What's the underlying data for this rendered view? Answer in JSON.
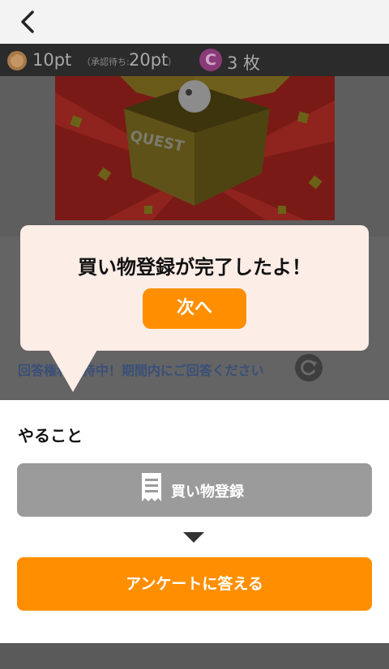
{
  "points": {
    "current": "10pt",
    "pending_label": "（承認待ち:",
    "pending_value": "20pt",
    "pending_close": "）",
    "coin_letter": "C",
    "tickets": "3 枚"
  },
  "hero": {
    "box_text": "QUEST"
  },
  "status": {
    "text": "回答権利保持中！期間内にご回答ください"
  },
  "popup": {
    "title": "買い物登録が完了したよ！",
    "next_label": "次へ"
  },
  "todo": {
    "title": "やること",
    "step_done_label": "買い物登録",
    "survey_label": "アンケートに答える"
  },
  "colors": {
    "accent": "#ff8f00",
    "popup_bg": "#fcede6",
    "done_step": "#9b9b9b"
  },
  "icons": {
    "back": "chevron-left-icon",
    "pig": "piggy-bank-icon",
    "coin": "coin-c-icon",
    "reload": "refresh-icon",
    "receipt": "receipt-icon",
    "arrow": "triangle-down-icon"
  }
}
